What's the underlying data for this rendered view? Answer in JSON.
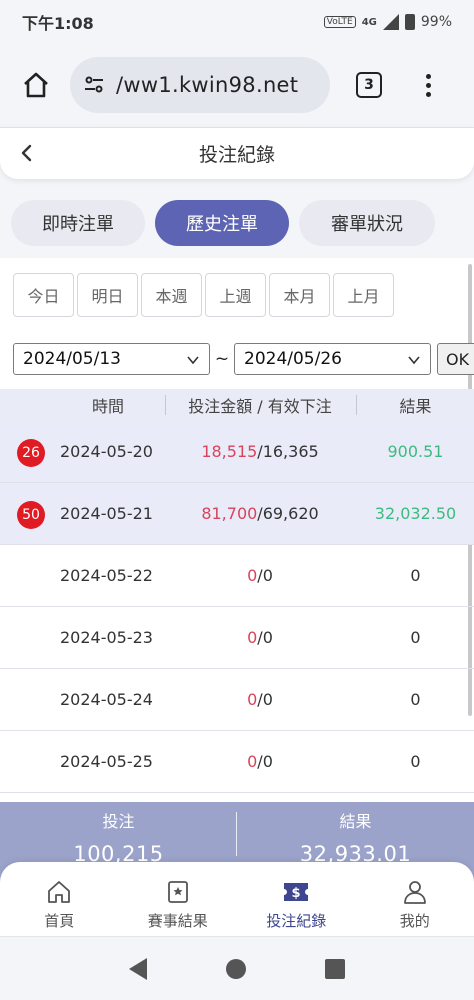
{
  "status_bar": {
    "time": "下午1:08",
    "network": "4G",
    "volte": "VoLTE",
    "battery": "99%"
  },
  "browser": {
    "url": "/ww1.kwin98.net",
    "tab_count": "3"
  },
  "header": {
    "title": "投注紀錄"
  },
  "main_tabs": [
    {
      "label": "即時注單",
      "active": false
    },
    {
      "label": "歷史注單",
      "active": true
    },
    {
      "label": "審單狀況",
      "active": false
    }
  ],
  "quick_filters": [
    "今日",
    "明日",
    "本週",
    "上週",
    "本月",
    "上月"
  ],
  "date_range": {
    "start": "2024/05/13",
    "separator": "~",
    "end": "2024/05/26",
    "ok_label": "OK"
  },
  "table": {
    "headers": {
      "time": "時間",
      "bet": "投注金額 / 有效下注",
      "result": "結果"
    },
    "rows": [
      {
        "badge": "26",
        "date": "2024-05-20",
        "bet_amount": "18,515",
        "valid_bet": "/16,365",
        "result": "900.51",
        "highlight": true
      },
      {
        "badge": "50",
        "date": "2024-05-21",
        "bet_amount": "81,700",
        "valid_bet": "/69,620",
        "result": "32,032.50",
        "highlight": true
      },
      {
        "badge": "",
        "date": "2024-05-22",
        "bet_amount": "0",
        "valid_bet": "/0",
        "result": "0",
        "highlight": false
      },
      {
        "badge": "",
        "date": "2024-05-23",
        "bet_amount": "0",
        "valid_bet": "/0",
        "result": "0",
        "highlight": false
      },
      {
        "badge": "",
        "date": "2024-05-24",
        "bet_amount": "0",
        "valid_bet": "/0",
        "result": "0",
        "highlight": false
      },
      {
        "badge": "",
        "date": "2024-05-25",
        "bet_amount": "0",
        "valid_bet": "/0",
        "result": "0",
        "highlight": false
      }
    ]
  },
  "summary": {
    "bet_label": "投注",
    "bet_value": "100,215",
    "result_label": "結果",
    "result_value": "32,933.01"
  },
  "bottom_nav": [
    {
      "label": "首頁",
      "icon": "home-icon",
      "active": false
    },
    {
      "label": "賽事結果",
      "icon": "star-book-icon",
      "active": false
    },
    {
      "label": "投注紀錄",
      "icon": "dollar-ticket-icon",
      "active": true
    },
    {
      "label": "我的",
      "icon": "user-icon",
      "active": false
    }
  ],
  "colors": {
    "accent": "#5d64b3",
    "summary_bg": "#9ba3ca",
    "badge_red": "#e01b24",
    "amount_red": "#d9435b",
    "result_green": "#3dbb7e"
  }
}
